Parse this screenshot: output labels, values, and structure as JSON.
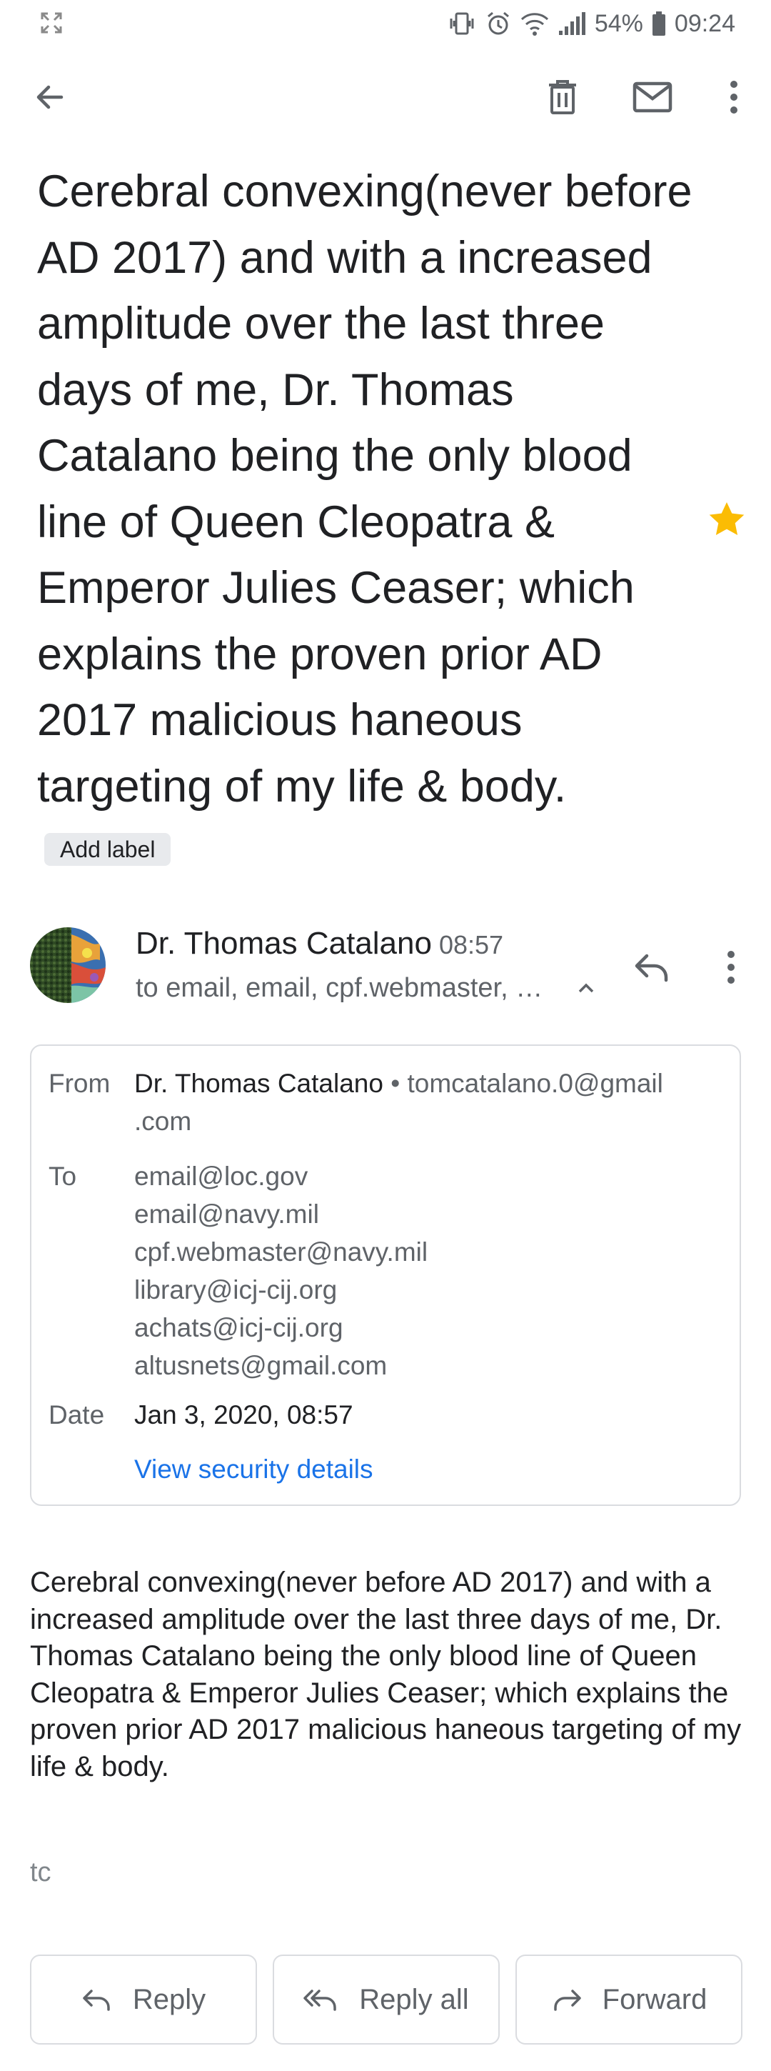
{
  "status_bar": {
    "battery": "54%",
    "time": "09:24",
    "icons": [
      "screen-expand-icon",
      "vibrate-icon",
      "alarm-icon",
      "wifi-icon",
      "signal-icon",
      "battery-icon"
    ]
  },
  "toolbar": {
    "icons": [
      "back-arrow-icon",
      "trash-icon",
      "mail-icon",
      "more-vert-icon"
    ]
  },
  "email": {
    "subject": "Cerebral convexing(never before AD 2017) and with a increased amplitude over the last three days of me, Dr. Thomas Catalano being the only blood line of Queen Cleopatra & Emperor Julies Ceaser; which explains the proven prior AD 2017 malicious haneous targeting of my life & body.",
    "label_chip": "Add label",
    "starred": true,
    "star_color": "#fbbc04",
    "sender_name": "Dr. Thomas Catalano",
    "sender_time": "08:57",
    "recipients_summary": "to email, email, cpf.webmaster, …",
    "details": {
      "from_label": "From",
      "from_name": "Dr. Thomas Catalano",
      "from_separator": "•",
      "from_email_line1": "tomcatalano.0@gmail",
      "from_email_line2": ".com",
      "to_label": "To",
      "to": [
        "email@loc.gov",
        "email@navy.mil",
        "cpf.webmaster@navy.mil",
        "library@icj-cij.org",
        "achats@icj-cij.org",
        "altusnets@gmail.com"
      ],
      "date_label": "Date",
      "date": "Jan 3, 2020, 08:57",
      "security_link": "View security details"
    },
    "body": "Cerebral convexing(never before AD 2017) and with a increased amplitude over the last three days of me, Dr. Thomas Catalano being the only blood line of Queen Cleopatra & Emperor Julies Ceaser; which explains the proven prior AD 2017 malicious haneous targeting of my life & body.",
    "signature": "tc"
  },
  "actions": {
    "reply": "Reply",
    "reply_all": "Reply all",
    "forward": "Forward"
  },
  "colors": {
    "link": "#1a73e8",
    "border": "#dadce0",
    "icon": "#5f6368"
  }
}
